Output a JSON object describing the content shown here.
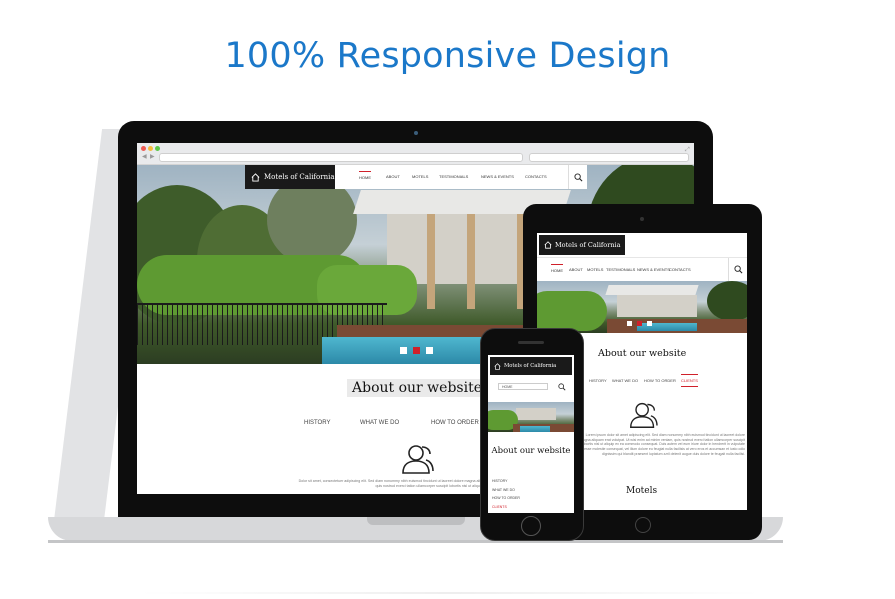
{
  "headline": "100% Responsive Design",
  "site": {
    "logo_text": "Motels of California",
    "nav": [
      "HOME",
      "ABOUT",
      "MOTELS",
      "TESTIMONIALS",
      "NEWS & EVENTS",
      "CONTACTS"
    ],
    "section_title": "About our website",
    "tabs": [
      "HISTORY",
      "WHAT WE DO",
      "HOW TO ORDER",
      "CLIENTS"
    ],
    "lorem_short": "Dolor sit amet, consectetuer adipiscing elit. Sed diam nonummy nibh euismod tincidunt ut laoreet dolore magna aliquam erat volutpat. Ut wisi enim ad minim veniam, quis nostrud exerci tation ullamcorper suscipit lobortis nisl ut aliquip.",
    "lorem_long": "Lorem ipsum dolor sit amet adipiscing elit. Sed diam nonummy nibh euismod tincidunt ut laoreet dolore magna aliquam erat volutpat. Ut wisi enim ad minim veniam, quis nostrud exerci tation ullamcorper suscipit lobortis nisl ut aliquip ex ea commodo consequat. Duis autem vel eum iriure dolor in hendrerit in vulputate velit esse molestie consequat, vel illum dolore eu feugiat nulla facilisis at vero eros et accumsan et iusto odio dignissim qui blandit praesent luptatum zzril delenit augue duis dolore te feugait nulla facilisi.",
    "motels_title": "Motels",
    "mobile_menu_label": "HOME"
  },
  "colors": {
    "headline": "#1b78c9",
    "accent": "#d0202a",
    "logo_bg": "#1a1a1a"
  }
}
